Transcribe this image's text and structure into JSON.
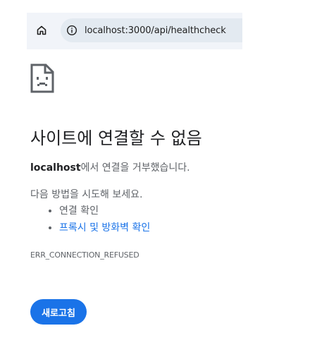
{
  "browser": {
    "url": "localhost:3000/api/healthcheck"
  },
  "error": {
    "title": "사이트에 연결할 수 없음",
    "host": "localhost",
    "detail_suffix": "에서 연결을 거부했습니다.",
    "suggest_heading": "다음 방법을 시도해 보세요.",
    "suggestions": [
      {
        "label": "연결 확인",
        "is_link": false
      },
      {
        "label": "프록시 및 방화벽 확인",
        "is_link": true
      }
    ],
    "code": "ERR_CONNECTION_REFUSED",
    "reload_label": "새로고침"
  },
  "colors": {
    "accent": "#1a73e8",
    "title_text": "#202124",
    "body_text": "#5f6368",
    "toolbar_bg": "#f1f4f9",
    "omnibox_bg": "#e3eaf1"
  },
  "icons": {
    "home": "home-icon",
    "info": "info-icon",
    "sad_document": "sad-document-icon"
  }
}
